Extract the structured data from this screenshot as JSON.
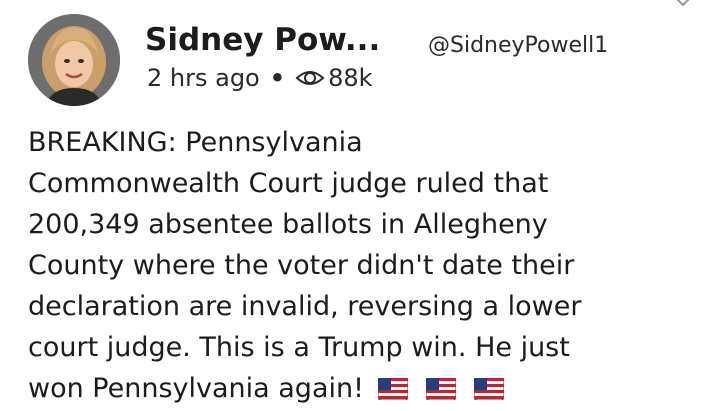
{
  "post": {
    "author": {
      "display_name": "Sidney Pow...",
      "handle": "@SidneyPowell1"
    },
    "meta": {
      "time": "2 hrs ago",
      "separator": "•",
      "views": "88k",
      "views_icon": "eye-icon"
    },
    "body_lines": [
      "BREAKING: Pennsylvania",
      "Commonwealth Court judge ruled that",
      "200,349 absentee ballots in Allegheny",
      "County where the voter didn't date their",
      "declaration are invalid, reversing a lower",
      "court judge. This is a Trump win. He just",
      "won Pennsylvania again!"
    ],
    "emoji": [
      "us-flag-emoji",
      "us-flag-emoji",
      "us-flag-emoji"
    ]
  },
  "colors": {
    "text": "#1c1c1c",
    "background": "#ffffff"
  }
}
